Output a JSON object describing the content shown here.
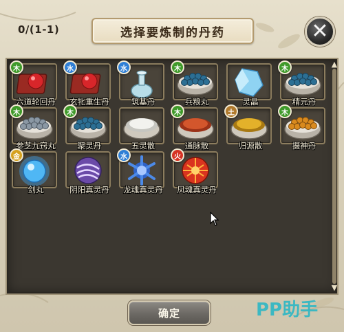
{
  "header": {
    "counter": "0/(1-1)",
    "title": "选择要炼制的丹药"
  },
  "controls": {
    "close_glyph": "✕",
    "confirm_label": "确定",
    "scroll_up_glyph": "▲",
    "scroll_down_glyph": "▼"
  },
  "watermark": "PP助手",
  "elements": {
    "wood": {
      "label": "木",
      "color": "#3f9a2a"
    },
    "water": {
      "label": "水",
      "color": "#2f7fd6"
    },
    "earth": {
      "label": "土",
      "color": "#b07a2e"
    },
    "metal": {
      "label": "金",
      "color": "#d6a11e"
    },
    "fire": {
      "label": "火",
      "color": "#d63324"
    }
  },
  "items": [
    {
      "name": "六道轮回丹",
      "element": "木",
      "icon": "red-pill-box-icon"
    },
    {
      "name": "玄牝重生丹",
      "element": "水",
      "icon": "red-pill-box-icon"
    },
    {
      "name": "筑基丹",
      "element": "水",
      "icon": "gourd-vase-icon"
    },
    {
      "name": "兵粮丸",
      "element": "木",
      "icon": "blue-pellet-bowl-icon"
    },
    {
      "name": "灵晶",
      "element": "",
      "icon": "ice-crystal-icon"
    },
    {
      "name": "精元丹",
      "element": "木",
      "icon": "blue-pellet-bowl-icon"
    },
    {
      "name": "参芝九窍丸",
      "element": "木",
      "icon": "grey-pellet-bowl-icon"
    },
    {
      "name": "聚灵丹",
      "element": "木",
      "icon": "blue-pellet-bowl-icon"
    },
    {
      "name": "五灵散",
      "element": "",
      "icon": "white-powder-bowl-icon"
    },
    {
      "name": "通脉散",
      "element": "木",
      "icon": "red-powder-bowl-icon"
    },
    {
      "name": "归源散",
      "element": "土",
      "icon": "yellow-powder-bowl-icon"
    },
    {
      "name": "摄神丹",
      "element": "木",
      "icon": "orange-pellet-bowl-icon"
    },
    {
      "name": "剑丸",
      "element": "金",
      "icon": "glowing-blue-orb-icon"
    },
    {
      "name": "阴阳真灵丹",
      "element": "",
      "icon": "purple-swirl-orb-icon"
    },
    {
      "name": "龙魂真灵丹",
      "element": "水",
      "icon": "blue-spiky-orb-icon"
    },
    {
      "name": "凤魂真灵丹",
      "element": "火",
      "icon": "red-flame-orb-icon"
    }
  ]
}
